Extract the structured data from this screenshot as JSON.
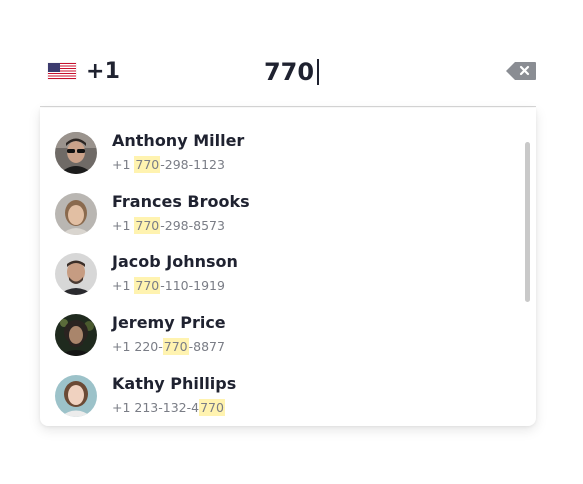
{
  "country": {
    "flag_icon": "us-flag-icon",
    "dial_code": "+1"
  },
  "input": {
    "value": "770"
  },
  "backspace": {
    "icon": "backspace-icon",
    "color": "#8a8d93"
  },
  "highlight_color": "#fff3b0",
  "contacts": [
    {
      "name": "Anthony Miller",
      "phone_before": "+1 ",
      "phone_match": "770",
      "phone_after": "-298-1123"
    },
    {
      "name": "Frances Brooks",
      "phone_before": "+1 ",
      "phone_match": "770",
      "phone_after": "-298-8573"
    },
    {
      "name": "Jacob Johnson",
      "phone_before": "+1 ",
      "phone_match": "770",
      "phone_after": "-110-1919"
    },
    {
      "name": "Jeremy Price",
      "phone_before": "+1 220-",
      "phone_match": "770",
      "phone_after": "-8877"
    },
    {
      "name": "Kathy Phillips",
      "phone_before": "+1 213-132-4",
      "phone_match": "770",
      "phone_after": ""
    }
  ]
}
